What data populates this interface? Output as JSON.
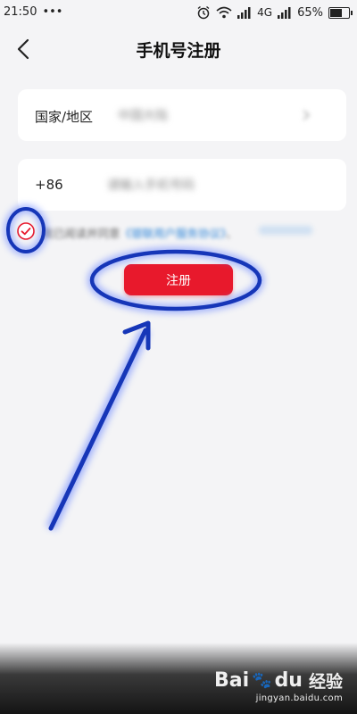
{
  "status_bar": {
    "time": "21:50",
    "dots": "•••",
    "network": "4G",
    "battery": "65%",
    "battery_level": 0.65
  },
  "header": {
    "title": "手机号注册"
  },
  "form": {
    "country_label": "国家/地区",
    "country_value": "中国大陆",
    "phone_prefix": "+86",
    "phone_placeholder": "请输入手机号码"
  },
  "agreement": {
    "text": "我已阅读并同意",
    "link": "《银联用户服务协议》",
    "separator": "、"
  },
  "actions": {
    "register_label": "注册"
  },
  "watermark": {
    "brand_latin": "Bai",
    "brand_paw": "🐾",
    "brand_du": "du",
    "brand_cn": "经验",
    "url": "jingyan.baidu.com"
  },
  "colors": {
    "accent": "#e8192c",
    "link": "#2f86d9",
    "annotation": "#1636b8"
  }
}
